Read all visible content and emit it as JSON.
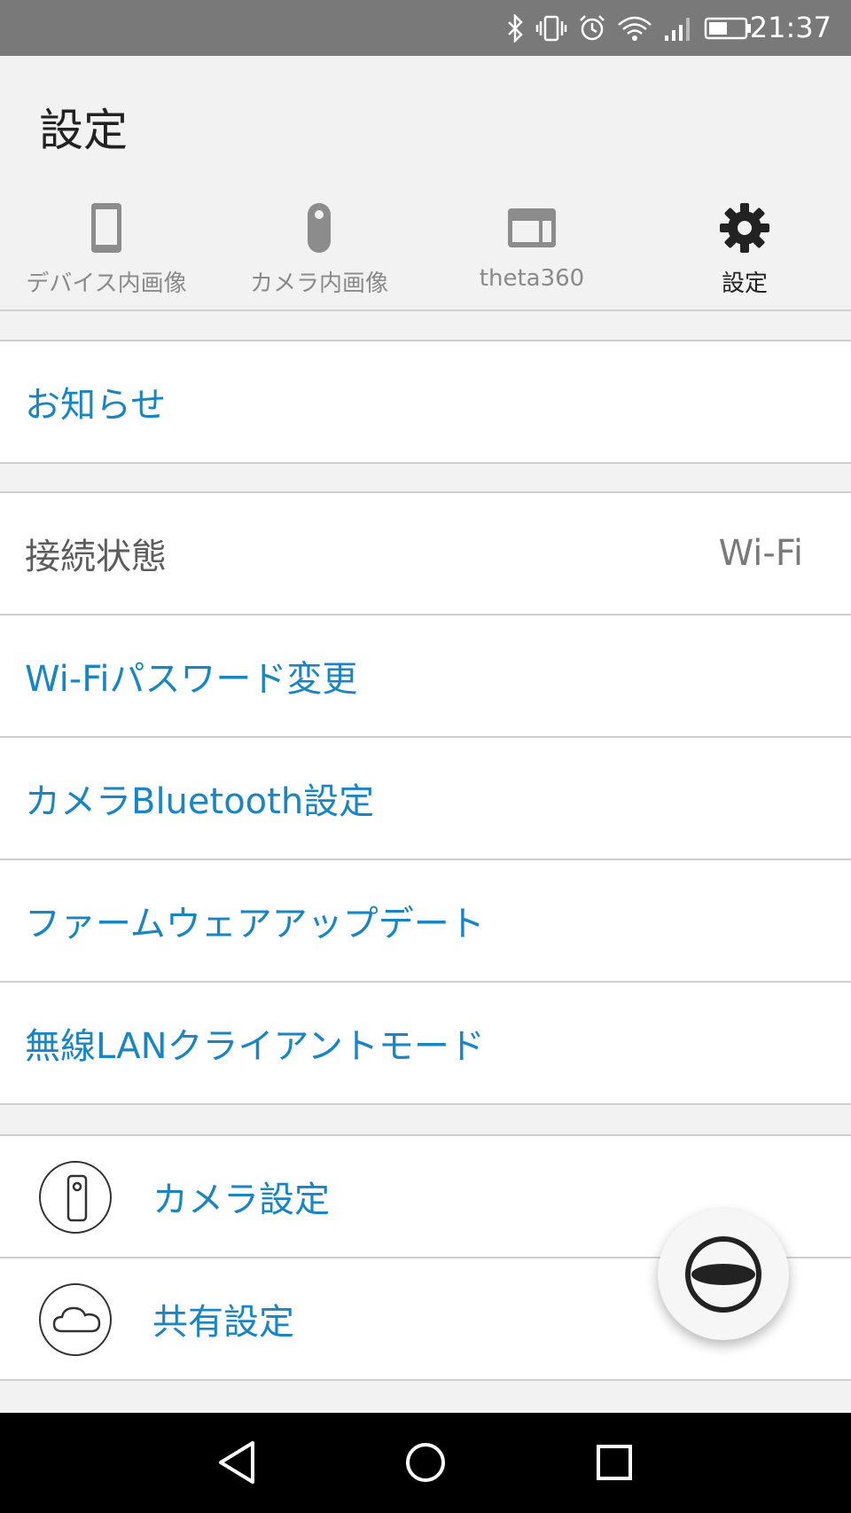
{
  "status_bar": {
    "time": "21:37",
    "icons": [
      "bluetooth-icon",
      "vibrate-icon",
      "alarm-icon",
      "wifi-icon",
      "signal-icon",
      "battery-icon"
    ]
  },
  "header": {
    "title": "設定",
    "tabs": [
      {
        "label": "デバイス内画像",
        "icon": "phone-icon",
        "active": false
      },
      {
        "label": "カメラ内画像",
        "icon": "camera-device-icon",
        "active": false
      },
      {
        "label": "theta360",
        "icon": "browser-window-icon",
        "active": false
      },
      {
        "label": "設定",
        "icon": "gear-icon",
        "active": true
      }
    ]
  },
  "groups": {
    "news": {
      "label": "お知らせ"
    },
    "connection": {
      "status_label": "接続状態",
      "status_value": "Wi-Fi",
      "items": [
        {
          "label": "Wi-Fiパスワード変更"
        },
        {
          "label": "カメラBluetooth設定"
        },
        {
          "label": "ファームウェアアップデート"
        },
        {
          "label": "無線LANクライアントモード"
        }
      ]
    },
    "settings": {
      "items": [
        {
          "label": "カメラ設定",
          "icon": "camera-icon"
        },
        {
          "label": "共有設定",
          "icon": "cloud-icon"
        }
      ]
    }
  },
  "fab": {
    "icon": "theta-shutter-icon"
  },
  "nav_bar": {
    "buttons": [
      "back-icon",
      "home-icon",
      "recents-icon"
    ]
  },
  "colors": {
    "accent": "#1a85c3",
    "status_bar": "#797979",
    "background": "#f2f2f2",
    "divider": "#cfcfcf"
  }
}
